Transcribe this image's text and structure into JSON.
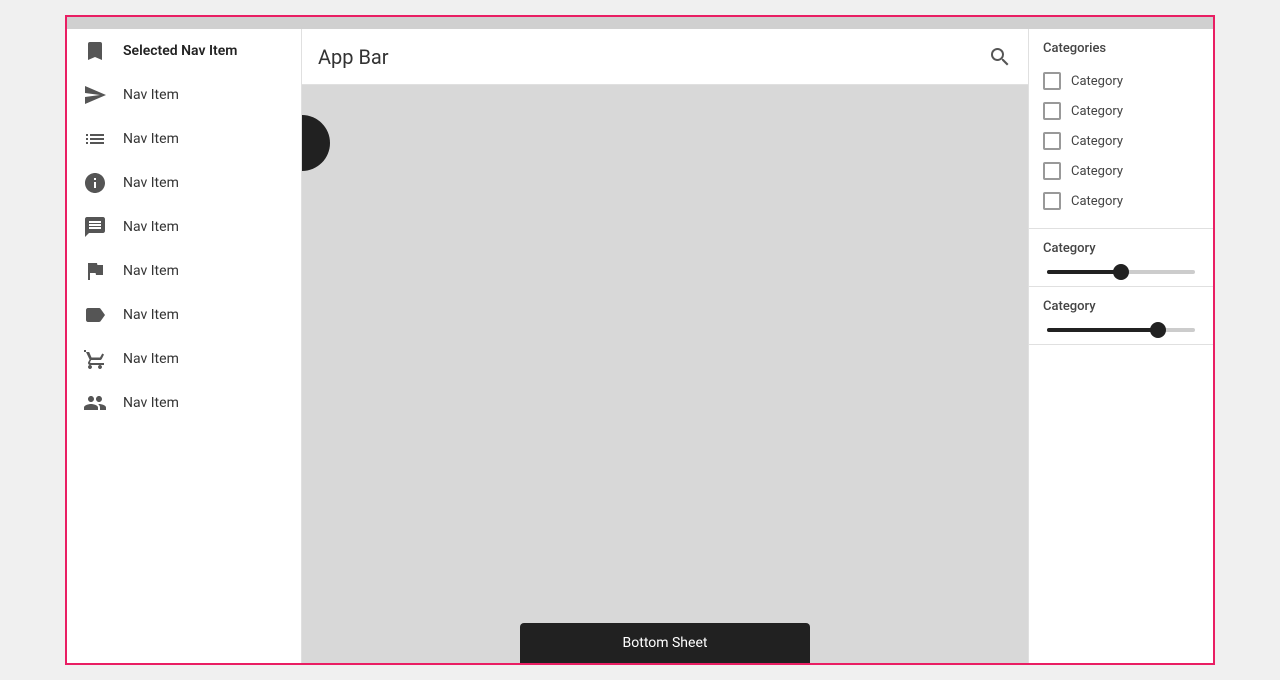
{
  "topBar": {},
  "sidebar": {
    "items": [
      {
        "id": "selected-nav",
        "label": "Selected Nav Item",
        "selected": true,
        "icon": "bookmark"
      },
      {
        "id": "nav-1",
        "label": "Nav Item",
        "selected": false,
        "icon": "send"
      },
      {
        "id": "nav-2",
        "label": "Nav Item",
        "selected": false,
        "icon": "list"
      },
      {
        "id": "nav-3",
        "label": "Nav Item",
        "selected": false,
        "icon": "info"
      },
      {
        "id": "nav-4",
        "label": "Nav Item",
        "selected": false,
        "icon": "chat"
      },
      {
        "id": "nav-5",
        "label": "Nav Item",
        "selected": false,
        "icon": "flag"
      },
      {
        "id": "nav-6",
        "label": "Nav Item",
        "selected": false,
        "icon": "tag"
      },
      {
        "id": "nav-7",
        "label": "Nav Item",
        "selected": false,
        "icon": "cart"
      },
      {
        "id": "nav-8",
        "label": "Nav Item",
        "selected": false,
        "icon": "group"
      }
    ]
  },
  "appBar": {
    "title": "App Bar",
    "searchLabel": "search"
  },
  "rightPanel": {
    "sections": [
      {
        "title": "Categories",
        "type": "checkboxes",
        "items": [
          {
            "label": "Category",
            "checked": false
          },
          {
            "label": "Category",
            "checked": false
          },
          {
            "label": "Category",
            "checked": false
          },
          {
            "label": "Category",
            "checked": false
          },
          {
            "label": "Category",
            "checked": false
          }
        ]
      },
      {
        "title": "Category",
        "type": "slider",
        "value": 50,
        "fillPercent": 50
      },
      {
        "title": "Category",
        "type": "slider",
        "value": 75,
        "fillPercent": 75
      }
    ]
  },
  "bottomSheet": {
    "label": "Bottom Sheet"
  },
  "colors": {
    "accent": "#e91e63",
    "dark": "#212121",
    "border": "#e0e0e0"
  }
}
